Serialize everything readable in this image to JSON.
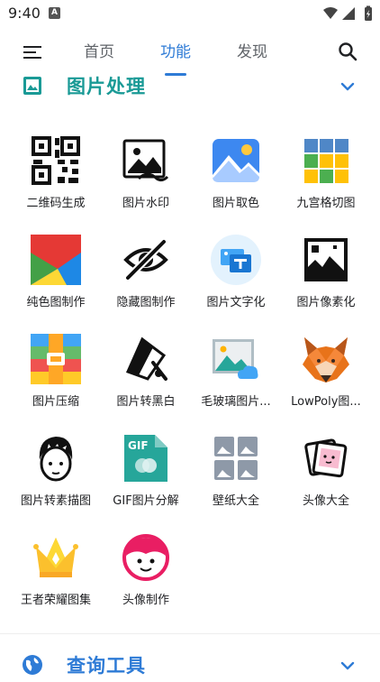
{
  "status": {
    "time": "9:40",
    "notif": "A"
  },
  "tabs": [
    {
      "label": "首页"
    },
    {
      "label": "功能"
    },
    {
      "label": "发现"
    }
  ],
  "sections": [
    {
      "title": "图片处理"
    },
    {
      "title": "查询工具"
    }
  ],
  "tools": [
    {
      "label": "二维码生成",
      "icon": "qr-code-icon"
    },
    {
      "label": "图片水印",
      "icon": "image-watermark-icon"
    },
    {
      "label": "图片取色",
      "icon": "color-picker-image-icon"
    },
    {
      "label": "九宫格切图",
      "icon": "nine-grid-icon"
    },
    {
      "label": "纯色图制作",
      "icon": "solid-color-icon"
    },
    {
      "label": "隐藏图制作",
      "icon": "hidden-eye-icon"
    },
    {
      "label": "图片文字化",
      "icon": "image-to-text-icon"
    },
    {
      "label": "图片像素化",
      "icon": "pixelate-icon"
    },
    {
      "label": "图片压缩",
      "icon": "compress-icon"
    },
    {
      "label": "图片转黑白",
      "icon": "black-white-icon"
    },
    {
      "label": "毛玻璃图片...",
      "icon": "frosted-glass-icon"
    },
    {
      "label": "LowPoly图...",
      "icon": "lowpoly-fox-icon"
    },
    {
      "label": "图片转素描图",
      "icon": "sketch-face-icon"
    },
    {
      "label": "GIF图片分解",
      "icon": "gif-icon"
    },
    {
      "label": "壁纸大全",
      "icon": "wallpaper-icon"
    },
    {
      "label": "头像大全",
      "icon": "avatar-collection-icon"
    },
    {
      "label": "王者荣耀图集",
      "icon": "crown-icon"
    },
    {
      "label": "头像制作",
      "icon": "avatar-maker-icon"
    }
  ]
}
